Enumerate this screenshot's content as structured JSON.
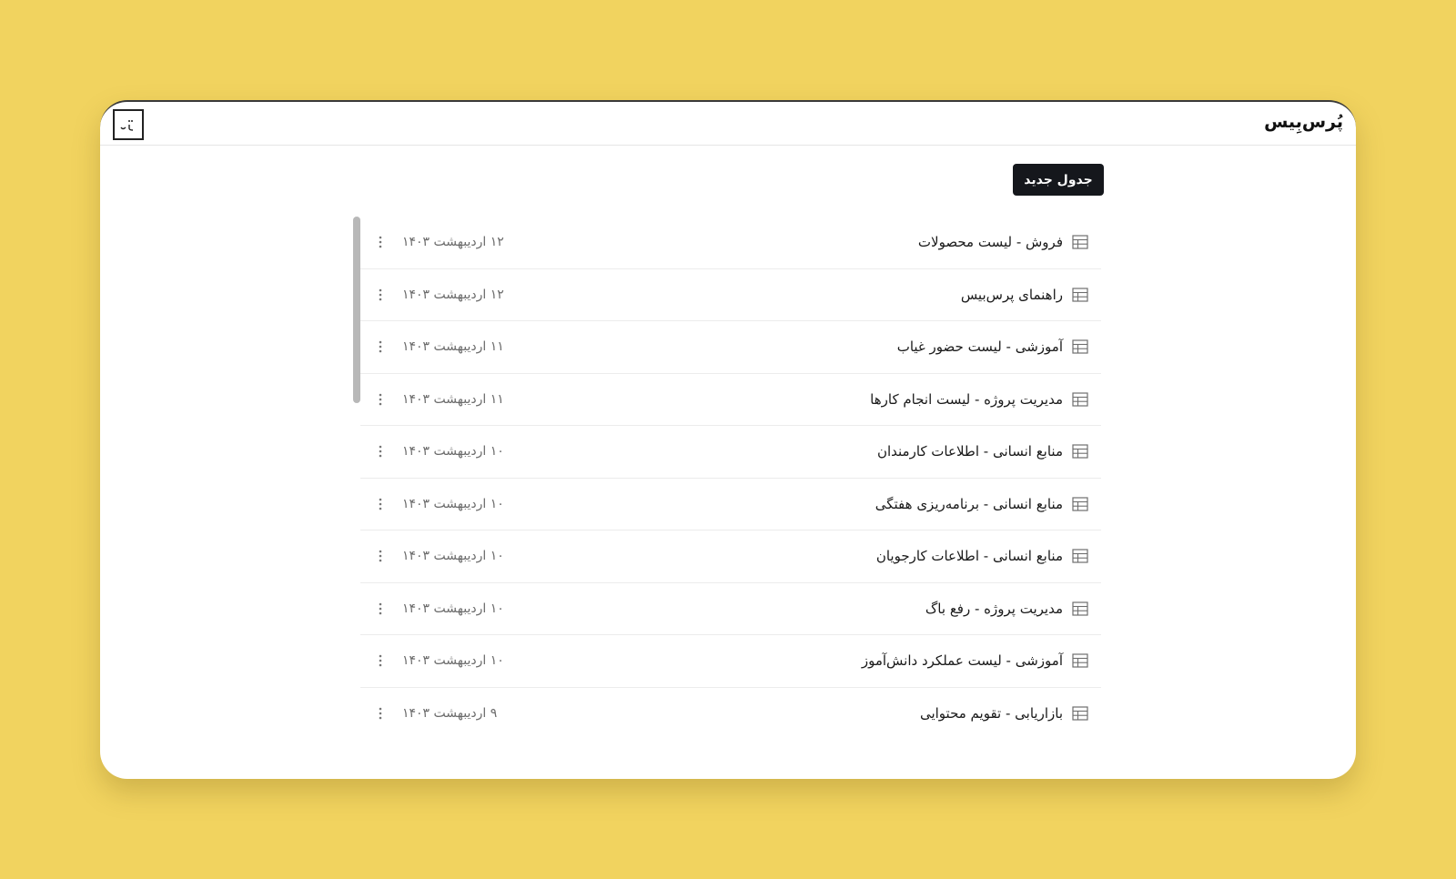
{
  "app": {
    "brand": "پُرس‌بِیس",
    "logo_icon": "logo-icon"
  },
  "toolbar": {
    "new_table_label": "جدول جدید"
  },
  "colors": {
    "background": "#F1D35F",
    "button": "#15171c",
    "window": "#ffffff"
  },
  "tables": [
    {
      "title": "فروش - لیست محصولات",
      "date": "۱۲ اردیبهشت ۱۴۰۳",
      "icon": "table-icon"
    },
    {
      "title": "راهنمای پرس‌بیس",
      "date": "۱۲ اردیبهشت ۱۴۰۳",
      "icon": "table-icon"
    },
    {
      "title": "آموزشی - لیست حضور غیاب",
      "date": "۱۱ اردیبهشت ۱۴۰۳",
      "icon": "table-icon"
    },
    {
      "title": "مدیریت پروژه - لیست انجام کارها",
      "date": "۱۱ اردیبهشت ۱۴۰۳",
      "icon": "table-icon"
    },
    {
      "title": "منابع انسانی - اطلاعات کارمندان",
      "date": "۱۰ اردیبهشت ۱۴۰۳",
      "icon": "table-icon"
    },
    {
      "title": "منابع انسانی - برنامه‌ریزی هفتگی",
      "date": "۱۰ اردیبهشت ۱۴۰۳",
      "icon": "table-icon"
    },
    {
      "title": "منابع انسانی - اطلاعات کارجویان",
      "date": "۱۰ اردیبهشت ۱۴۰۳",
      "icon": "table-icon"
    },
    {
      "title": "مدیریت پروژه - رفع باگ",
      "date": "۱۰ اردیبهشت ۱۴۰۳",
      "icon": "table-icon"
    },
    {
      "title": "آموزشی - لیست عملکرد دانش‌آموز",
      "date": "۱۰ اردیبهشت ۱۴۰۳",
      "icon": "table-icon"
    },
    {
      "title": "بازاریابی - تقویم محتوایی",
      "date": "۹ اردیبهشت ۱۴۰۳",
      "icon": "table-icon"
    }
  ]
}
